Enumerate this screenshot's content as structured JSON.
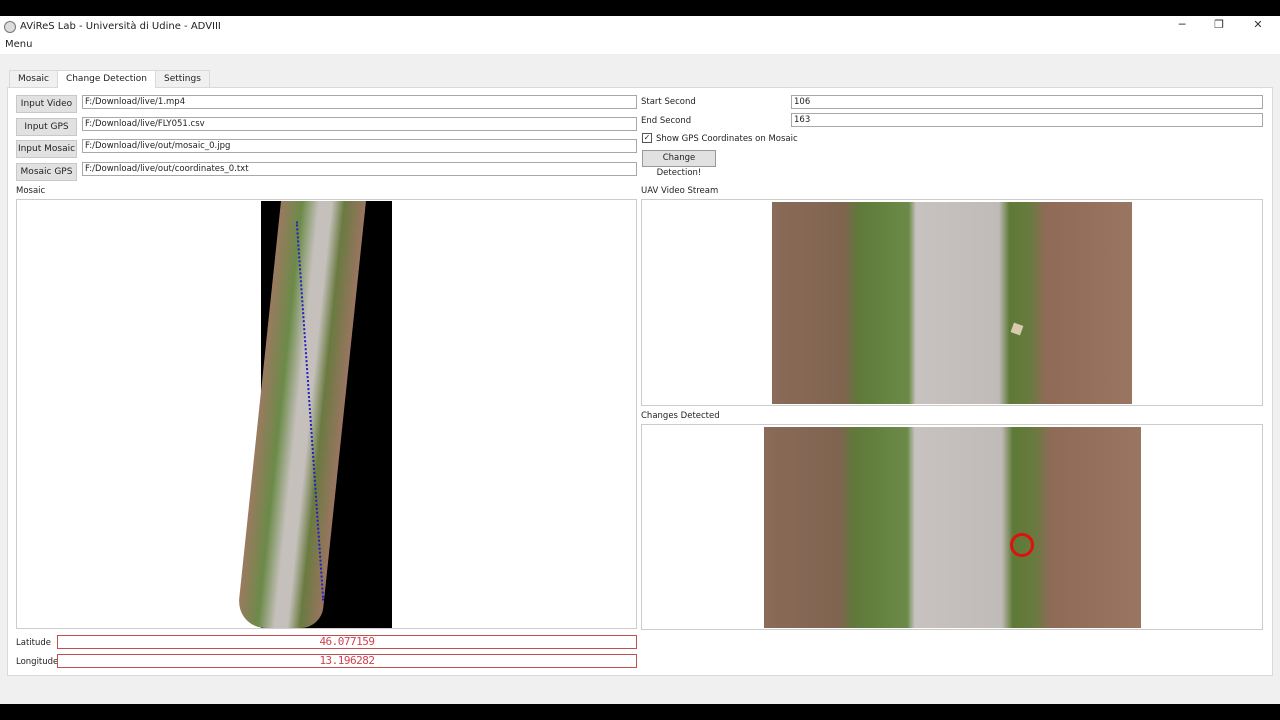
{
  "window": {
    "title": "AViReS Lab - Università di Udine - ADVIII",
    "minimize": "─",
    "maximize": "❐",
    "close": "✕"
  },
  "menubar": {
    "menu": "Menu"
  },
  "tabs": [
    {
      "label": "Mosaic"
    },
    {
      "label": "Change Detection",
      "active": true
    },
    {
      "label": "Settings"
    }
  ],
  "inputs": [
    {
      "button": "Input Video",
      "value": "F:/Download/live/1.mp4"
    },
    {
      "button": "Input GPS",
      "value": "F:/Download/live/FLY051.csv"
    },
    {
      "button": "Input Mosaic",
      "value": "F:/Download/live/out/mosaic_0.jpg"
    },
    {
      "button": "Mosaic GPS",
      "value": "F:/Download/live/out/coordinates_0.txt"
    }
  ],
  "params": {
    "start_label": "Start Second",
    "start_value": "106",
    "end_label": "End Second",
    "end_value": "163",
    "checkbox_label": "Show GPS Coordinates on Mosaic",
    "checkbox_checked": true,
    "run_button": "Change Detection!"
  },
  "sections": {
    "mosaic": "Mosaic",
    "stream": "UAV Video Stream",
    "changes": "Changes Detected"
  },
  "coords": {
    "lat_label": "Latitude",
    "lat_value": "46.077159",
    "lon_label": "Longitude",
    "lon_value": "13.196282"
  },
  "colors": {
    "lcd": "#d04050",
    "detection_circle": "#e01010"
  }
}
